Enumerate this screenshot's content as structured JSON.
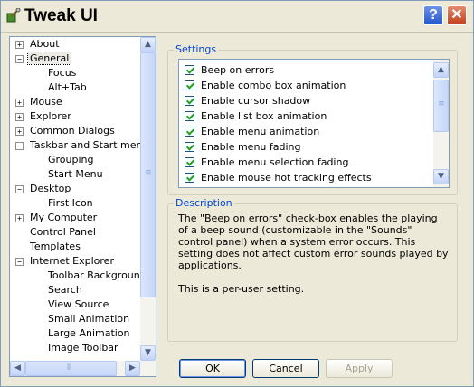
{
  "window": {
    "title": "Tweak UI",
    "help_glyph": "?",
    "close_glyph": "✕"
  },
  "tree": {
    "items": [
      {
        "label": "About",
        "level": 0,
        "expander": "+"
      },
      {
        "label": "General",
        "level": 0,
        "expander": "−",
        "selected": true
      },
      {
        "label": "Focus",
        "level": 1
      },
      {
        "label": "Alt+Tab",
        "level": 1
      },
      {
        "label": "Mouse",
        "level": 0,
        "expander": "+"
      },
      {
        "label": "Explorer",
        "level": 0,
        "expander": "+"
      },
      {
        "label": "Common Dialogs",
        "level": 0,
        "expander": "+"
      },
      {
        "label": "Taskbar and Start menu",
        "level": 0,
        "expander": "−"
      },
      {
        "label": "Grouping",
        "level": 1
      },
      {
        "label": "Start Menu",
        "level": 1
      },
      {
        "label": "Desktop",
        "level": 0,
        "expander": "−"
      },
      {
        "label": "First Icon",
        "level": 1
      },
      {
        "label": "My Computer",
        "level": 0,
        "expander": "+"
      },
      {
        "label": "Control Panel",
        "level": 0
      },
      {
        "label": "Templates",
        "level": 0
      },
      {
        "label": "Internet Explorer",
        "level": 0,
        "expander": "−"
      },
      {
        "label": "Toolbar Background",
        "level": 1
      },
      {
        "label": "Search",
        "level": 1
      },
      {
        "label": "View Source",
        "level": 1
      },
      {
        "label": "Small Animation",
        "level": 1
      },
      {
        "label": "Large Animation",
        "level": 1
      },
      {
        "label": "Image Toolbar",
        "level": 1
      }
    ]
  },
  "settings": {
    "title": "Settings",
    "items": [
      {
        "label": "Beep on errors",
        "checked": true
      },
      {
        "label": "Enable combo box animation",
        "checked": true
      },
      {
        "label": "Enable cursor shadow",
        "checked": true
      },
      {
        "label": "Enable list box animation",
        "checked": true
      },
      {
        "label": "Enable menu animation",
        "checked": true
      },
      {
        "label": "Enable menu fading",
        "checked": true
      },
      {
        "label": "Enable menu selection fading",
        "checked": true
      },
      {
        "label": "Enable mouse hot tracking effects",
        "checked": true
      }
    ]
  },
  "description": {
    "title": "Description",
    "paragraph1": "The \"Beep on errors\" check-box enables the playing of a beep sound (customizable in the \"Sounds\" control panel) when a system error occurs.  This setting does not affect custom error sounds played by applications.",
    "paragraph2": "This is a per-user setting."
  },
  "buttons": {
    "ok": "OK",
    "cancel": "Cancel",
    "apply": "Apply"
  },
  "colors": {
    "accent": "#0046d5",
    "window_bg": "#ece9d8",
    "border": "#7f9db9"
  }
}
